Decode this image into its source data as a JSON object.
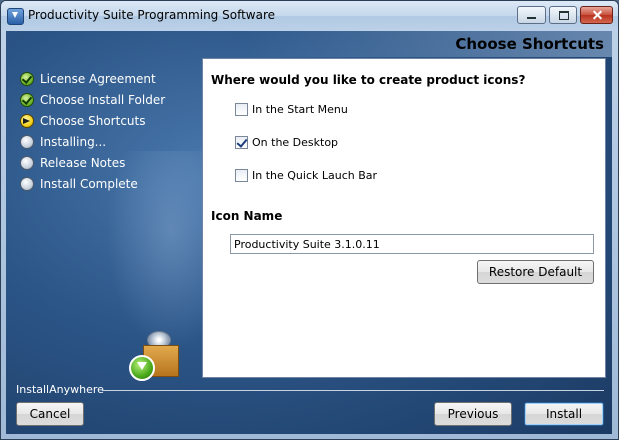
{
  "window": {
    "title": "Productivity Suite Programming Software"
  },
  "header": {
    "title": "Choose Shortcuts"
  },
  "steps": [
    {
      "label": "License Agreement",
      "status": "done"
    },
    {
      "label": "Choose Install Folder",
      "status": "done"
    },
    {
      "label": "Choose Shortcuts",
      "status": "current"
    },
    {
      "label": "Installing...",
      "status": "pending"
    },
    {
      "label": "Release Notes",
      "status": "pending"
    },
    {
      "label": "Install Complete",
      "status": "pending"
    }
  ],
  "content": {
    "question": "Where would you like to create product icons?",
    "options": [
      {
        "label": "In the Start Menu",
        "checked": false
      },
      {
        "label": "On the Desktop",
        "checked": true
      },
      {
        "label": "In the Quick Lauch Bar",
        "checked": false
      }
    ],
    "icon_name_label": "Icon Name",
    "icon_name_value": "Productivity Suite 3.1.0.11",
    "restore_label": "Restore Default"
  },
  "footer": {
    "brand": "InstallAnywhere",
    "cancel_label": "Cancel",
    "previous_label": "Previous",
    "install_label": "Install"
  },
  "colors": {
    "sidebar": "#2c5688",
    "accent": "#2b5f9a"
  }
}
